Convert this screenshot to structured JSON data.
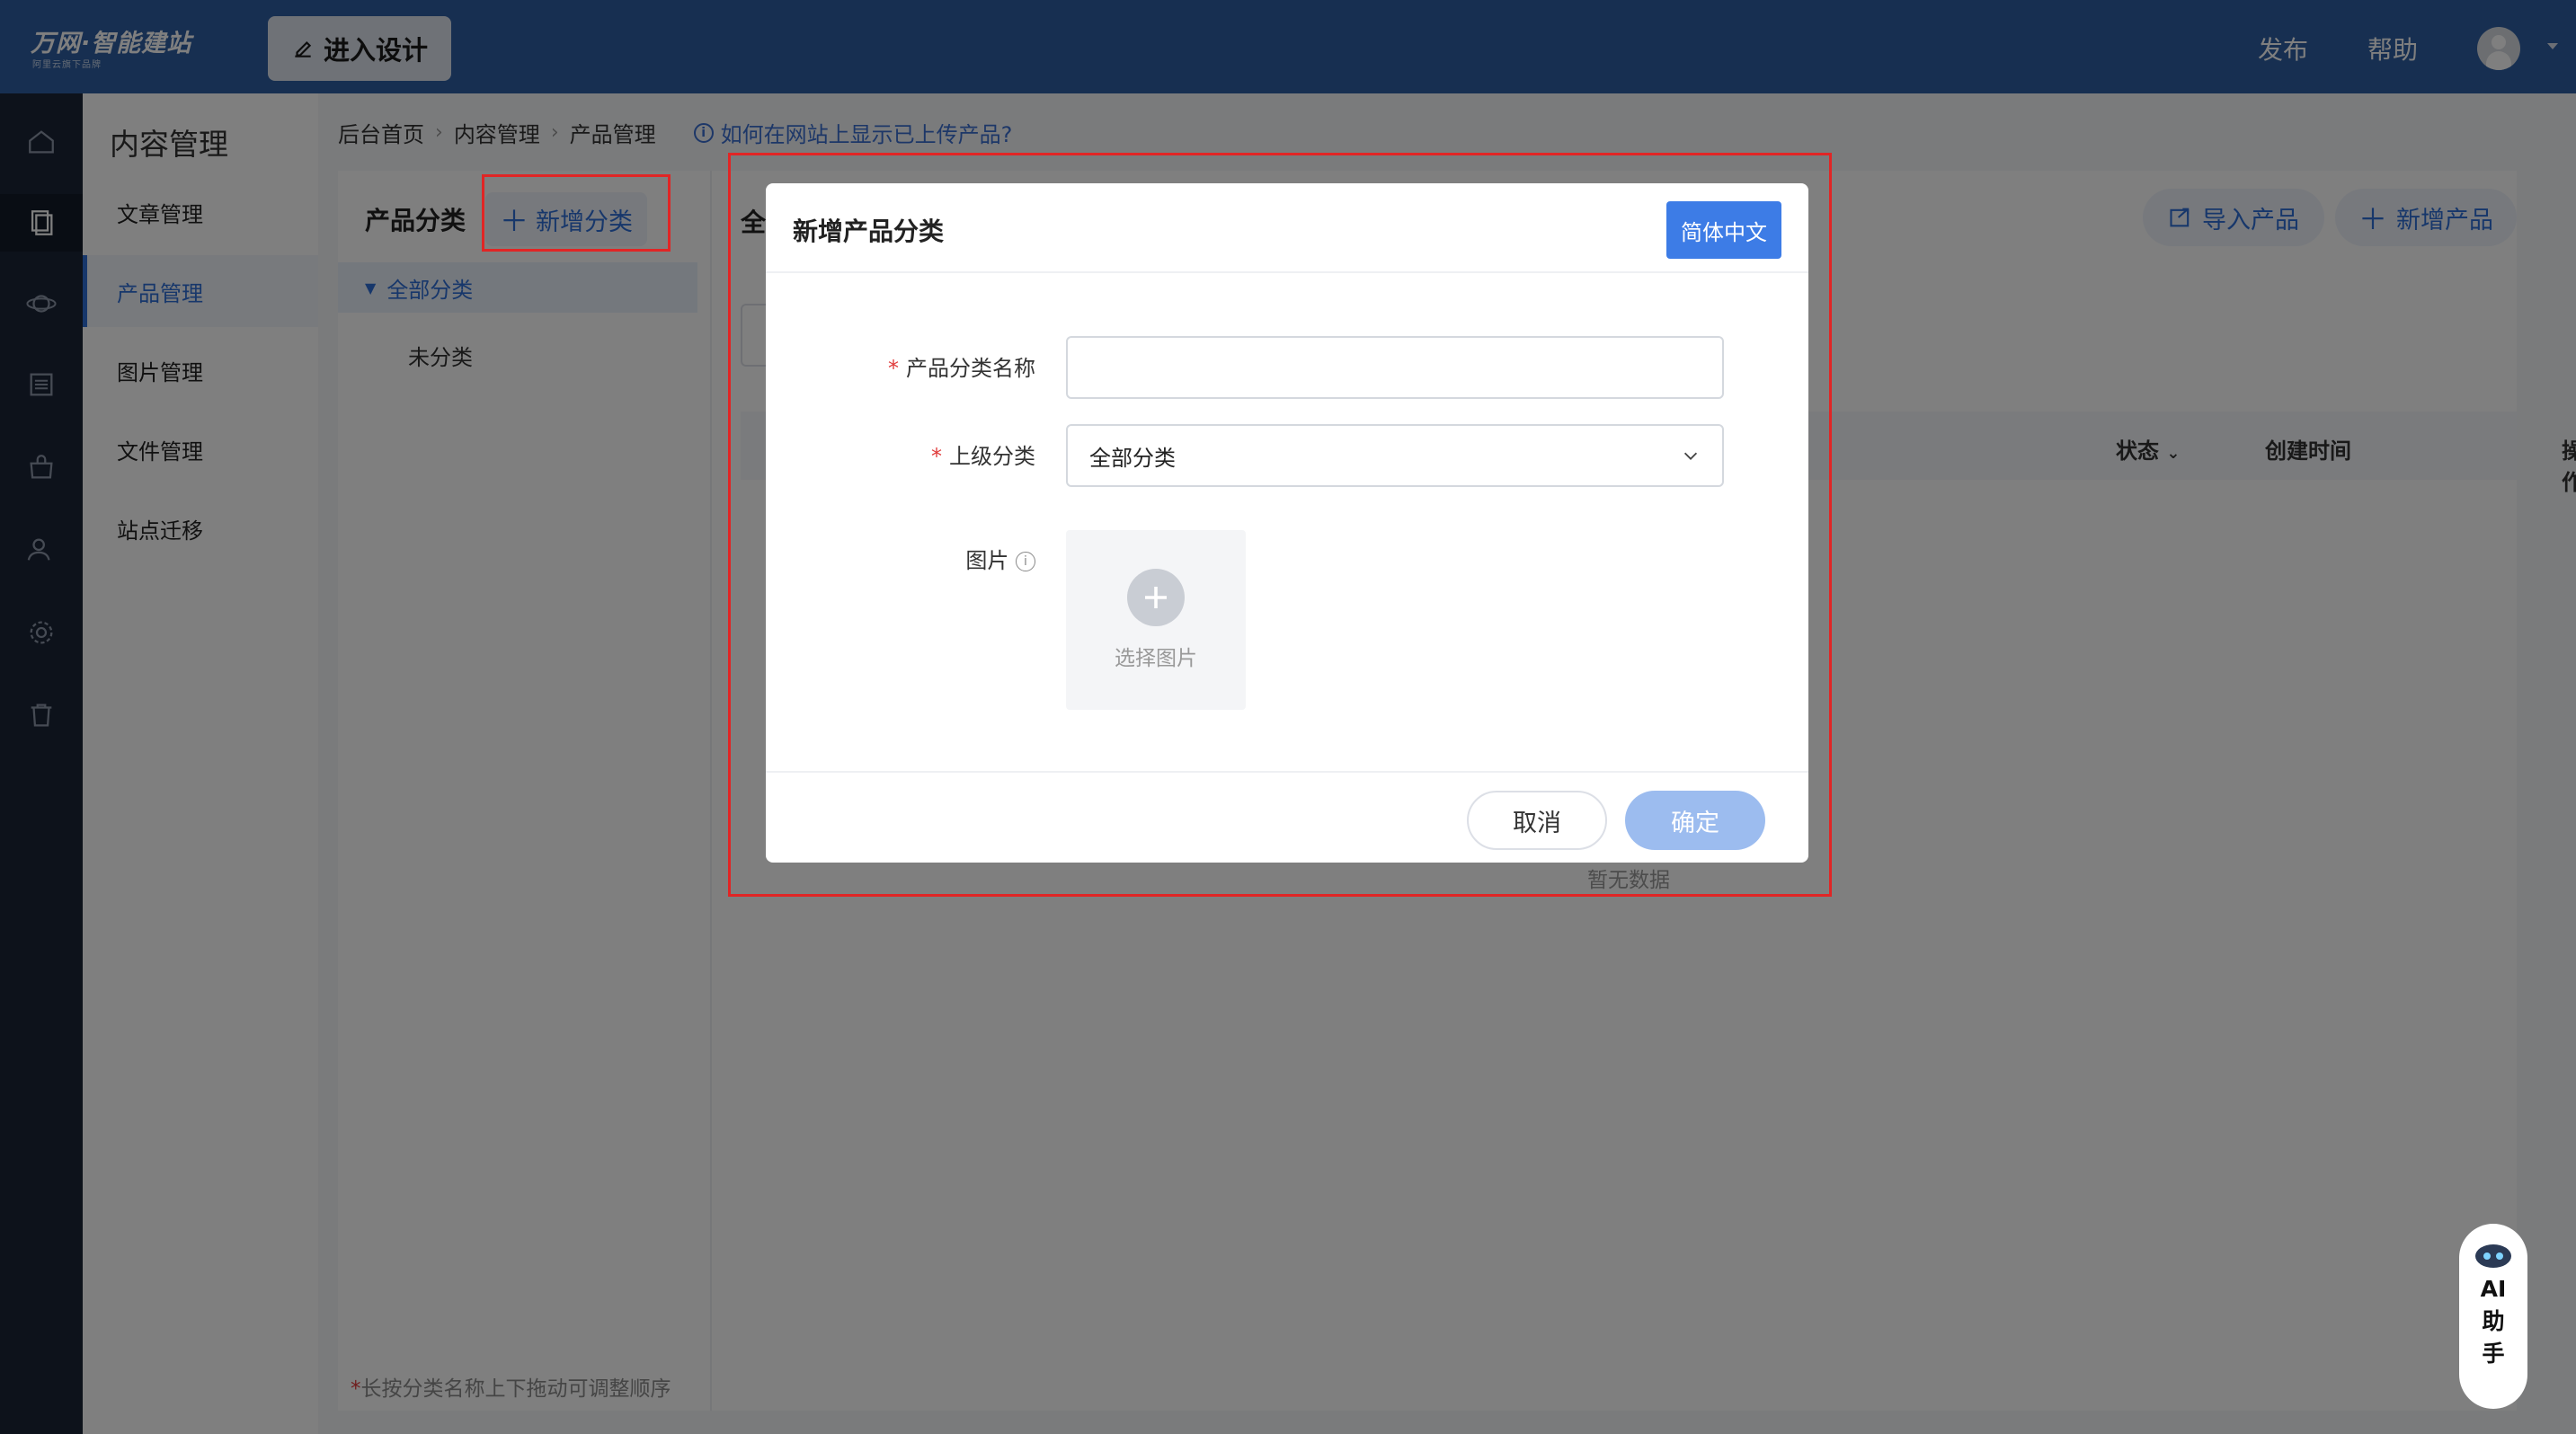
{
  "topbar": {
    "logo": "万网·智能建站",
    "logo_sub": "阿里云旗下品牌",
    "design_button": "进入设计",
    "publish": "发布",
    "help": "帮助"
  },
  "rail": {
    "icons": [
      "home-icon",
      "content-icon",
      "planet-icon",
      "list-icon",
      "shop-bag-icon",
      "users-icon",
      "settings-icon",
      "trash-icon"
    ]
  },
  "subnav": {
    "title": "内容管理",
    "items": [
      {
        "label": "文章管理"
      },
      {
        "label": "产品管理"
      },
      {
        "label": "图片管理"
      },
      {
        "label": "文件管理"
      },
      {
        "label": "站点迁移"
      }
    ]
  },
  "breadcrumb": {
    "items": [
      "后台首页",
      "内容管理",
      "产品管理"
    ],
    "help_link": "如何在网站上显示已上传产品?"
  },
  "content": {
    "category_title": "产品分类",
    "add_category": "新增分类",
    "tree_root": "全部分类",
    "tree_child": "未分类",
    "drag_tip_star": "*",
    "drag_tip": "长按分类名称上下拖动可调整顺序",
    "right_title_partial": "全",
    "import_button": "导入产品",
    "new_product_button": "新增产品",
    "table_headers": [
      "状态",
      "创建时间",
      "操作"
    ],
    "empty": "暂无数据"
  },
  "modal": {
    "title": "新增产品分类",
    "language": "简体中文",
    "name_label": "产品分类名称",
    "name_value": "",
    "parent_label": "上级分类",
    "parent_value": "全部分类",
    "image_label": "图片",
    "choose_image": "选择图片",
    "cancel": "取消",
    "confirm": "确定",
    "required_mark": "*"
  },
  "ai": {
    "label_line1": "AI",
    "label_line2": "助",
    "label_line3": "手"
  },
  "colors": {
    "topbar": "#2f5fa3",
    "accent": "#2f6fd6",
    "annotation": "#e12525",
    "confirm_disabled": "#9cbcef"
  }
}
